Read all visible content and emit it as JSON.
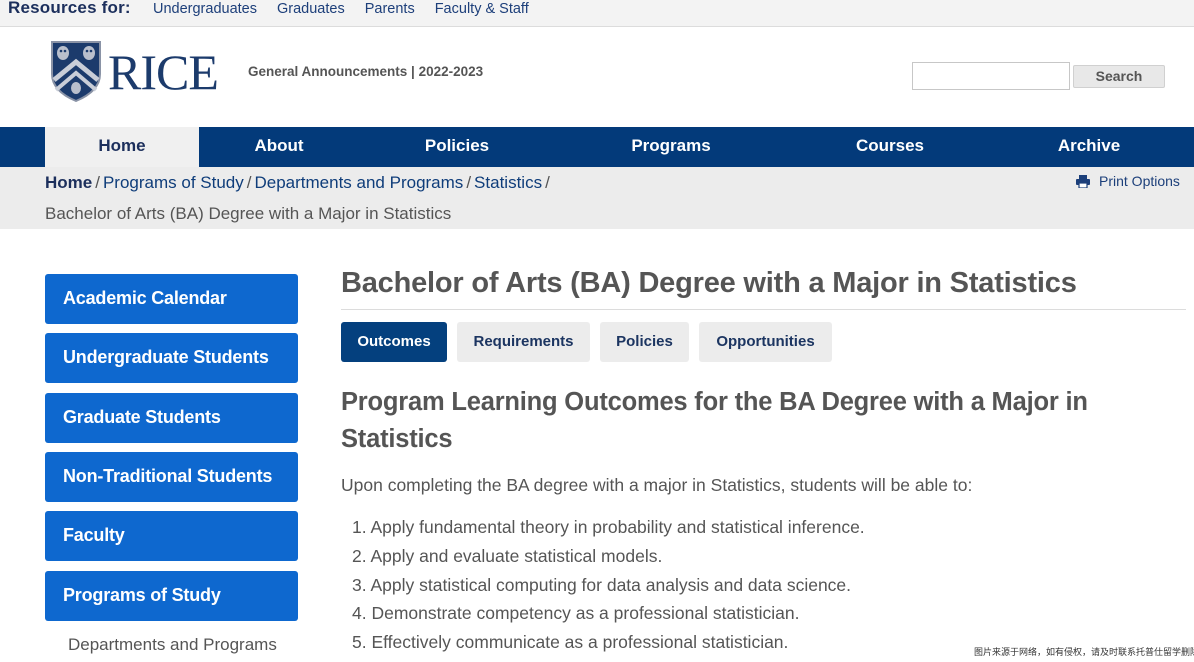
{
  "resources_bar": {
    "label": "Resources for:",
    "links": [
      "Undergraduates",
      "Graduates",
      "Parents",
      "Faculty & Staff"
    ]
  },
  "header": {
    "logo_text": "RICE",
    "title": "General Announcements | 2022-2023",
    "search": {
      "value": "",
      "button_label": "Search"
    }
  },
  "nav": {
    "items": [
      {
        "label": "Home",
        "active": true
      },
      {
        "label": "About"
      },
      {
        "label": "Policies"
      },
      {
        "label": "Programs"
      },
      {
        "label": "Courses"
      },
      {
        "label": "Archive"
      }
    ]
  },
  "breadcrumb": {
    "items": [
      "Home",
      "Programs of Study",
      "Departments and Programs",
      "Statistics"
    ],
    "separator": "/",
    "current": "Bachelor of Arts (BA) Degree with a Major in Statistics",
    "print_label": "Print Options"
  },
  "sidebar": {
    "items": [
      "Academic Calendar",
      "Undergraduate Students",
      "Graduate Students",
      "Non-Traditional Students",
      "Faculty",
      "Programs of Study"
    ],
    "sub_item": "Departments and Programs"
  },
  "content": {
    "title": "Bachelor of Arts (BA) Degree with a Major in Statistics",
    "tabs": [
      {
        "label": "Outcomes",
        "active": true
      },
      {
        "label": "Requirements"
      },
      {
        "label": "Policies"
      },
      {
        "label": "Opportunities"
      }
    ],
    "section_heading": "Program Learning Outcomes for the BA Degree with a Major in Statistics",
    "intro": "Upon completing the BA degree with a major in Statistics, students will be able to:",
    "outcomes": [
      "1. Apply fundamental theory in probability and statistical inference.",
      "2. Apply and evaluate statistical models.",
      "3. Apply statistical computing for data analysis and data science.",
      "4. Demonstrate competency as a professional statistician.",
      "5. Effectively communicate as a professional statistician."
    ]
  },
  "watermark": "图片来源于网络，如有侵权，请及时联系托普仕留学删除",
  "colors": {
    "nav_blue": "#033a7a",
    "sidebar_blue": "#0e68cf",
    "link_blue": "#0f3d7a",
    "active_tab": "#04407e"
  },
  "icons": [
    "shield-logo-icon",
    "printer-icon"
  ]
}
